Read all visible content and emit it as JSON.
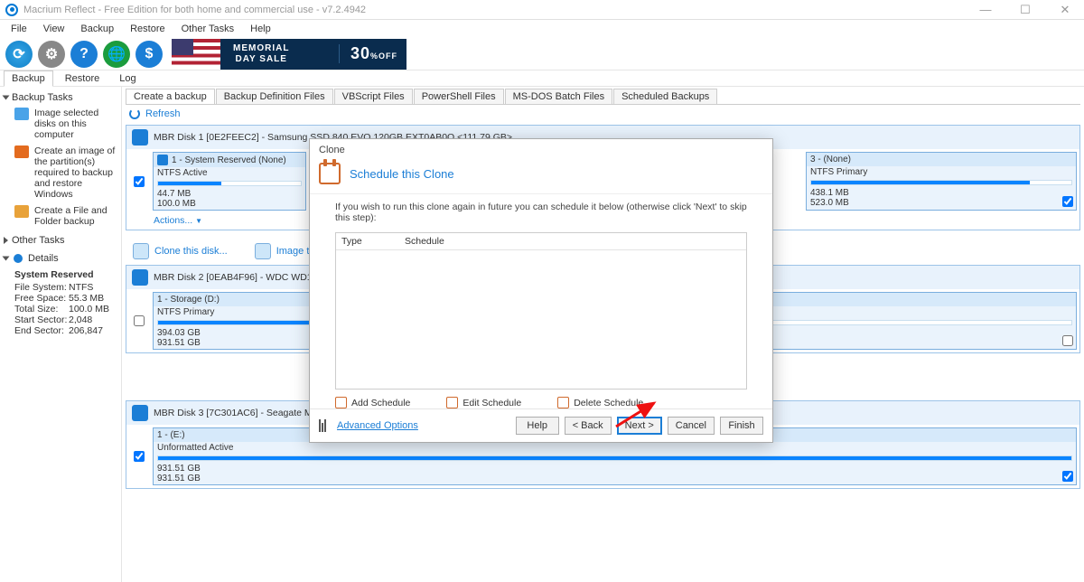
{
  "window": {
    "title": "Macrium Reflect - Free Edition for both home and commercial use - v7.2.4942"
  },
  "menus": [
    "File",
    "View",
    "Backup",
    "Restore",
    "Other Tasks",
    "Help"
  ],
  "promo": {
    "line1": "MEMORIAL",
    "line2": "DAY SALE",
    "pct": "30",
    "pct_suffix": "%OFF"
  },
  "sectabs": [
    "Backup",
    "Restore",
    "Log"
  ],
  "doctabs": [
    "Create a backup",
    "Backup Definition Files",
    "VBScript Files",
    "PowerShell Files",
    "MS-DOS Batch Files",
    "Scheduled Backups"
  ],
  "refresh_label": "Refresh",
  "sidebar": {
    "group1": "Backup Tasks",
    "items": [
      "Image selected disks on this computer",
      "Create an image of the partition(s) required to backup and restore Windows",
      "Create a File and Folder backup"
    ],
    "group2": "Other Tasks",
    "details_label": "Details",
    "details": {
      "header": "System Reserved",
      "rows": [
        {
          "k": "File System:",
          "v": "NTFS"
        },
        {
          "k": "Free Space:",
          "v": "55.3 MB"
        },
        {
          "k": "Total Size:",
          "v": "100.0 MB"
        },
        {
          "k": "Start Sector:",
          "v": "2,048"
        },
        {
          "k": "End Sector:",
          "v": "206,847"
        }
      ]
    }
  },
  "disks": [
    {
      "title": "MBR Disk 1 [0E2FEEC2] - Samsung SSD 840 EVO 120GB EXT0AB0Q  <111.79 GB>",
      "checked": true,
      "partA": {
        "head": "1 - System Reserved (None)",
        "fs": "NTFS Active",
        "used": "44.7 MB",
        "total": "100.0 MB",
        "fillPct": 44
      },
      "partB": {
        "head": "3 -  (None)",
        "fs": "NTFS Primary",
        "used": "438.1 MB",
        "total": "523.0 MB",
        "fillPct": 84,
        "checked": true
      },
      "actions_label": "Actions...",
      "links": [
        "Clone this disk...",
        "Image this disk..."
      ]
    },
    {
      "title": "MBR Disk 2 [0EAB4F96] - WDC WD10EZEX-00BN5A0 01.01A01",
      "checked": false,
      "partA": {
        "head": "1 - Storage (D:)",
        "fs": "NTFS Primary",
        "used": "394.03 GB",
        "total": "931.51 GB",
        "fillPct": 42,
        "checked": false
      }
    },
    {
      "title": "MBR Disk 3 [7C301AC6] - Seagate M3 Portable      9300  <931.51",
      "checked": true,
      "partA": {
        "head": "1 -  (E:)",
        "fs": "Unformatted Active",
        "used": "931.51 GB",
        "total": "931.51 GB",
        "fillPct": 100,
        "checked": true
      }
    }
  ],
  "modal": {
    "small_title": "Clone",
    "heading": "Schedule this Clone",
    "subtext": "If you wish to run this clone again in future you can schedule it below (otherwise click 'Next' to skip this step):",
    "col1": "Type",
    "col2": "Schedule",
    "sched_btns": [
      "Add Schedule",
      "Edit Schedule",
      "Delete Schedule"
    ],
    "adv": "Advanced Options",
    "buttons": {
      "help": "Help",
      "back": "< Back",
      "next": "Next >",
      "cancel": "Cancel",
      "finish": "Finish"
    }
  }
}
